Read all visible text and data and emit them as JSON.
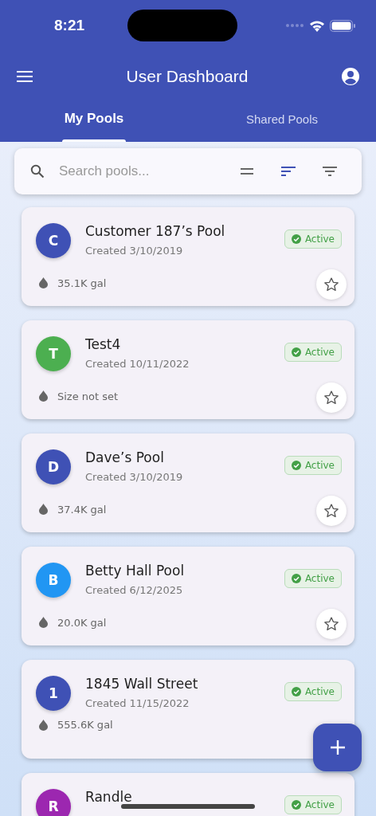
{
  "status_bar": {
    "time": "8:21"
  },
  "header": {
    "title": "User Dashboard"
  },
  "tabs": [
    {
      "label": "My Pools",
      "selected": true
    },
    {
      "label": "Shared Pools",
      "selected": false
    }
  ],
  "search": {
    "placeholder": "Search pools..."
  },
  "view_buttons": [
    {
      "kind": "density",
      "selected": false
    },
    {
      "kind": "sort",
      "selected": true
    },
    {
      "kind": "filter",
      "selected": false
    }
  ],
  "pools": [
    {
      "initial": "C",
      "color": "#3f51b5",
      "name": "Customer 187’s Pool",
      "created": "Created 3/10/2019",
      "status": "Active",
      "size": "35.1K gal",
      "favorite": false
    },
    {
      "initial": "T",
      "color": "#4caf50",
      "name": "Test4",
      "created": "Created 10/11/2022",
      "status": "Active",
      "size": "Size not set",
      "favorite": false
    },
    {
      "initial": "D",
      "color": "#3f51b5",
      "name": "Dave’s Pool",
      "created": "Created 3/10/2019",
      "status": "Active",
      "size": "37.4K gal",
      "favorite": false
    },
    {
      "initial": "B",
      "color": "#2196f3",
      "name": "Betty Hall Pool",
      "created": "Created 6/12/2025",
      "status": "Active",
      "size": "20.0K gal",
      "favorite": false
    },
    {
      "initial": "1",
      "color": "#3f51b5",
      "name": "1845 Wall Street",
      "created": "Created 11/15/2022",
      "status": "Active",
      "size": "555.6K gal"
    },
    {
      "initial": "R",
      "color": "#9c27b0",
      "name": "Randle",
      "status": "Active"
    }
  ]
}
